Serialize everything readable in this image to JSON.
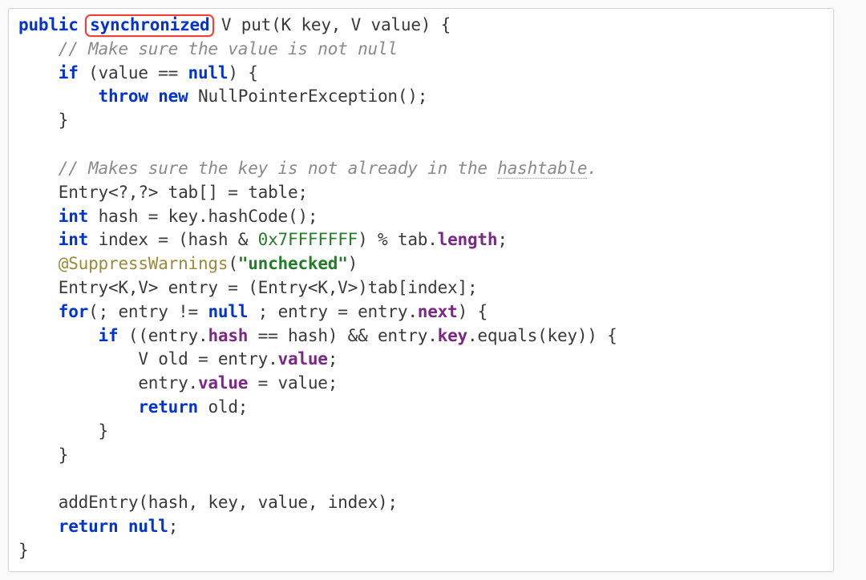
{
  "code": {
    "l01": {
      "kw1": "public",
      "kw2": "synchronized",
      "rest": " V put(K key, V value) {"
    },
    "l02": "    // Make sure the value is not null",
    "l03": {
      "a": "    ",
      "kw1": "if",
      "b": " (value == ",
      "kw2": "null",
      "c": ") {"
    },
    "l04": {
      "a": "        ",
      "kw1": "throw",
      "b": " ",
      "kw2": "new",
      "c": " NullPointerException();"
    },
    "l05": "    }",
    "l06": "",
    "l07": {
      "a": "    // Makes sure the key is not already in the ",
      "u": "hashtable",
      "b": "."
    },
    "l08": "    Entry<?,?> tab[] = table;",
    "l09": {
      "a": "    ",
      "kw": "int",
      "b": " hash = key.hashCode();"
    },
    "l10": {
      "a": "    ",
      "kw": "int",
      "b": " index = (hash & ",
      "hex": "0x7FFFFFFF",
      "c": ") % tab.",
      "fld": "length",
      "d": ";"
    },
    "l11": {
      "a": "    ",
      "ann": "@SuppressWarnings",
      "b": "(",
      "str": "\"unchecked\"",
      "c": ")"
    },
    "l12": "    Entry<K,V> entry = (Entry<K,V>)tab[index];",
    "l13": {
      "a": "    ",
      "kw1": "for",
      "b": "(; entry != ",
      "kw2": "null",
      "c": " ; entry = entry.",
      "fld": "next",
      "d": ") {"
    },
    "l14": {
      "a": "        ",
      "kw": "if",
      "b": " ((entry.",
      "fld1": "hash",
      "c": " == hash) && entry.",
      "fld2": "key",
      "d": ".equals(key)) {"
    },
    "l15": {
      "a": "            V old = entry.",
      "fld": "value",
      "b": ";"
    },
    "l16": {
      "a": "            entry.",
      "fld": "value",
      "b": " = value;"
    },
    "l17": {
      "a": "            ",
      "kw": "return",
      "b": " old;"
    },
    "l18": "        }",
    "l19": "    }",
    "l20": "",
    "l21": "    addEntry(hash, key, value, index);",
    "l22": {
      "a": "    ",
      "kw1": "return",
      "b": " ",
      "kw2": "null",
      "c": ";"
    },
    "l23": "}"
  }
}
